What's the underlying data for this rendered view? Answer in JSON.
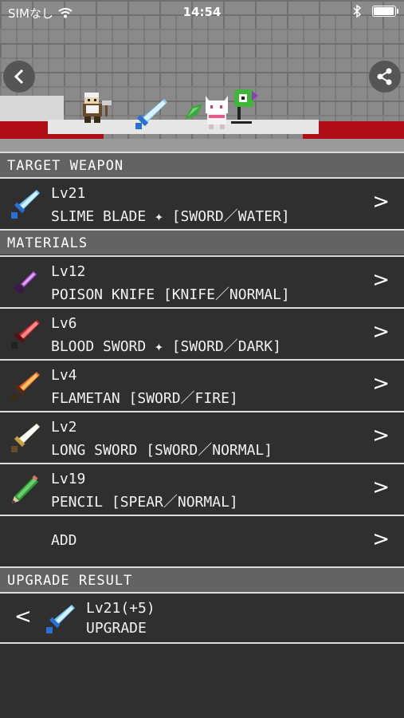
{
  "status_bar": {
    "carrier": "SIMなし",
    "time": "14:54"
  },
  "sections": {
    "target": "TARGET WEAPON",
    "materials": "MATERIALS",
    "result": "UPGRADE RESULT"
  },
  "target_weapon": {
    "level": "Lv21",
    "name": "SLIME BLADE ✦ [SWORD／WATER]",
    "icon": "blue-sword-icon"
  },
  "materials": [
    {
      "level": "Lv12",
      "name": "POISON KNIFE [KNIFE／NORMAL]",
      "icon": "purple-knife-icon",
      "color": "#8e2fb8"
    },
    {
      "level": "Lv6",
      "name": "BLOOD SWORD ✦ [SWORD／DARK]",
      "icon": "red-sword-icon",
      "color": "#d42a2a"
    },
    {
      "level": "Lv4",
      "name": "FLAMETAN [SWORD／FIRE]",
      "icon": "flame-sword-icon",
      "color": "#e8612a"
    },
    {
      "level": "Lv2",
      "name": "LONG SWORD [SWORD／NORMAL]",
      "icon": "white-sword-icon",
      "color": "#f4f1e0"
    },
    {
      "level": "Lv19",
      "name": "PENCIL [SPEAR／NORMAL]",
      "icon": "pencil-icon",
      "color": "#2f9a3a"
    }
  ],
  "add_label": "ADD",
  "result": {
    "level": "Lv21(+5)",
    "label": "UPGRADE"
  },
  "chevron": ">",
  "prev_chevron": "<"
}
